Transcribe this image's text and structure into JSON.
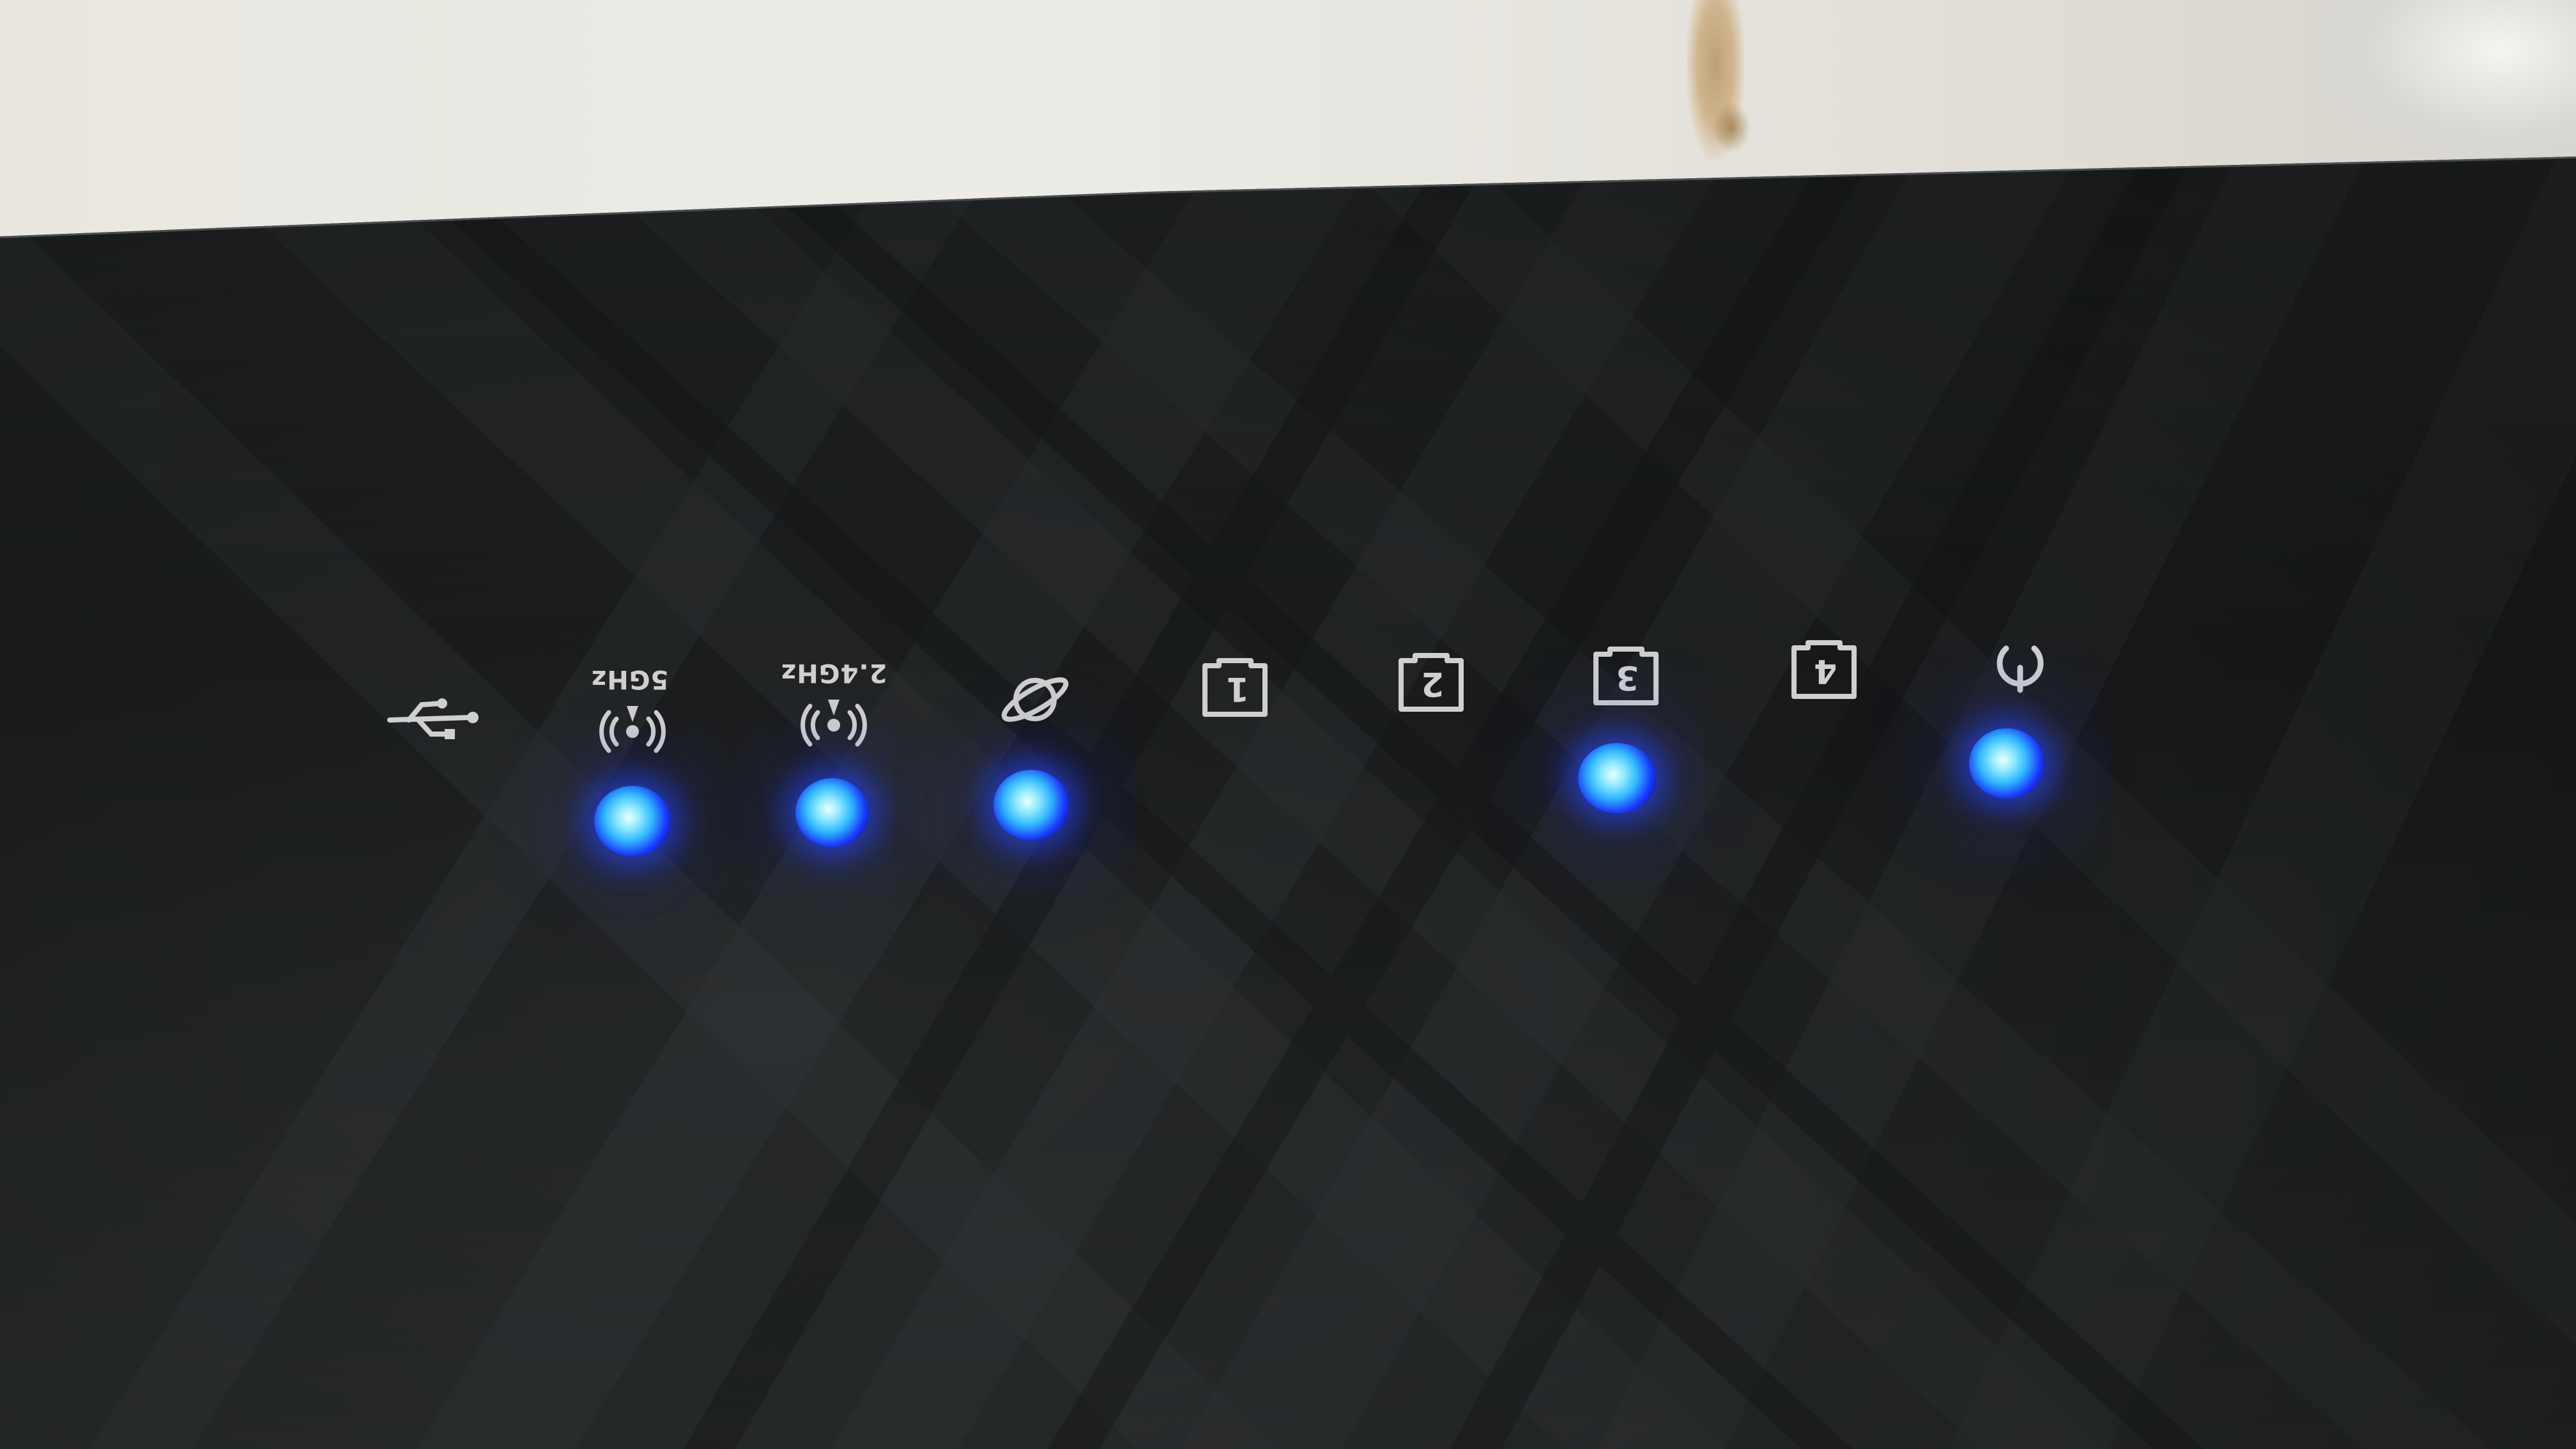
{
  "labels": {
    "band_5ghz": "5GHz",
    "band_24ghz": "2.4GHz",
    "lan1": "1",
    "lan2": "2",
    "lan3": "3",
    "lan4": "4"
  },
  "icons": {
    "usb": "usb-icon",
    "wifi_5ghz": "wifi-5ghz-icon",
    "wifi_24ghz": "wifi-2-4ghz-icon",
    "internet": "internet-planet-icon",
    "lan_port": "lan-port-icon",
    "power": "power-icon"
  },
  "led_status": {
    "usb": "off",
    "wifi_5ghz": "on",
    "wifi_24ghz": "on",
    "internet": "on",
    "lan1": "off",
    "lan2": "off",
    "lan3": "on",
    "lan4": "off",
    "power": "on"
  },
  "colors": {
    "led": "#1b3cff",
    "router_body": "#1f2122",
    "wall": "#e9e7e0",
    "glyph": "#d6d6d6"
  }
}
